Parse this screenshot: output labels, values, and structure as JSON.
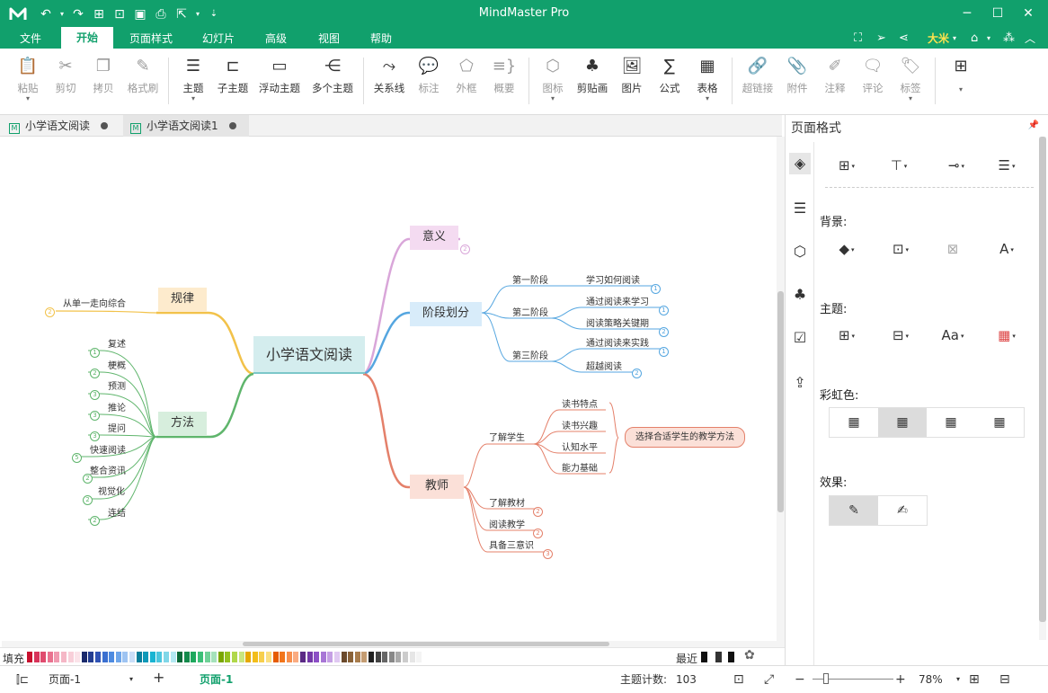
{
  "app": {
    "title": "MindMaster Pro",
    "menus": [
      "文件",
      "开始",
      "页面样式",
      "幻灯片",
      "高级",
      "视图",
      "帮助"
    ],
    "active_menu": "开始",
    "user": "大米",
    "brand_color": "#11a06c"
  },
  "ribbon": {
    "items": [
      {
        "label": "粘贴",
        "icon": "clipboard-icon",
        "enabled": false
      },
      {
        "label": "剪切",
        "icon": "scissors-icon",
        "enabled": false
      },
      {
        "label": "拷贝",
        "icon": "copy-icon",
        "enabled": false
      },
      {
        "label": "格式刷",
        "icon": "format-brush-icon",
        "enabled": false
      },
      {
        "label": "主题",
        "icon": "topic-icon",
        "enabled": true
      },
      {
        "label": "子主题",
        "icon": "subtopic-icon",
        "enabled": true
      },
      {
        "label": "浮动主题",
        "icon": "floating-topic-icon",
        "enabled": true
      },
      {
        "label": "多个主题",
        "icon": "multiple-topics-icon",
        "enabled": true
      },
      {
        "label": "关系线",
        "icon": "relationship-icon",
        "enabled": true
      },
      {
        "label": "标注",
        "icon": "callout-icon",
        "enabled": false
      },
      {
        "label": "外框",
        "icon": "boundary-icon",
        "enabled": false
      },
      {
        "label": "概要",
        "icon": "summary-icon",
        "enabled": false
      },
      {
        "label": "图标",
        "icon": "mark-icon",
        "enabled": false
      },
      {
        "label": "剪贴画",
        "icon": "clipart-icon",
        "enabled": true
      },
      {
        "label": "图片",
        "icon": "image-icon",
        "enabled": true
      },
      {
        "label": "公式",
        "icon": "formula-icon",
        "enabled": true
      },
      {
        "label": "表格",
        "icon": "table-icon",
        "enabled": true
      },
      {
        "label": "超链接",
        "icon": "hyperlink-icon",
        "enabled": false
      },
      {
        "label": "附件",
        "icon": "attachment-icon",
        "enabled": false
      },
      {
        "label": "注释",
        "icon": "note-icon",
        "enabled": false
      },
      {
        "label": "评论",
        "icon": "comment-icon",
        "enabled": false
      },
      {
        "label": "标签",
        "icon": "tag-icon",
        "enabled": false
      }
    ]
  },
  "tabs": [
    {
      "label": "小学语文阅读",
      "active": false
    },
    {
      "label": "小学语文阅读1",
      "active": true
    }
  ],
  "mindmap": {
    "central": "小学语文阅读",
    "topics": {
      "yiyi": "意义",
      "jieduan": "阶段划分",
      "jiaoshi": "教师",
      "guilv": "规律",
      "fangfa": "方法"
    },
    "jieduan_children": [
      "第一阶段",
      "第二阶段",
      "第三阶段"
    ],
    "jieduan_leaves": [
      "学习如何阅读",
      "通过阅读来学习",
      "阅读策略关键期",
      "通过阅读来实践",
      "超越阅读"
    ],
    "jiaoshi_children": [
      "了解学生",
      "了解教材",
      "阅读教学",
      "具备三意识"
    ],
    "xuesheng_leaves": [
      "读书特点",
      "读书兴趣",
      "认知水平",
      "能力基础"
    ],
    "jiaoshi_summary": "选择合适学生的教学方法",
    "guilv_child": "从单一走向综合",
    "fangfa_children": [
      "复述",
      "梗概",
      "预测",
      "推论",
      "提问",
      "快速阅读",
      "整合资讯",
      "视觉化",
      "连结"
    ],
    "badges": {
      "yiyi": "2",
      "guilv": "2",
      "jieduan": [
        "1",
        "1",
        "2",
        "1",
        "2"
      ],
      "jiaoshi": [
        "2",
        "2",
        "3"
      ],
      "fangfa": [
        "1",
        "2",
        "3",
        "3",
        "3",
        "5",
        "2",
        "2",
        "2"
      ]
    }
  },
  "right_panel": {
    "title": "页面格式",
    "background_label": "背景:",
    "theme_label": "主题:",
    "rainbow_label": "彩虹色:",
    "effects_label": "效果:"
  },
  "palette": {
    "fill_label": "填充",
    "recent_label": "最近"
  },
  "status": {
    "page_select": "页面-1",
    "page_tab": "页面-1",
    "topic_count_label": "主题计数:",
    "topic_count": "103",
    "zoom": "78%"
  }
}
